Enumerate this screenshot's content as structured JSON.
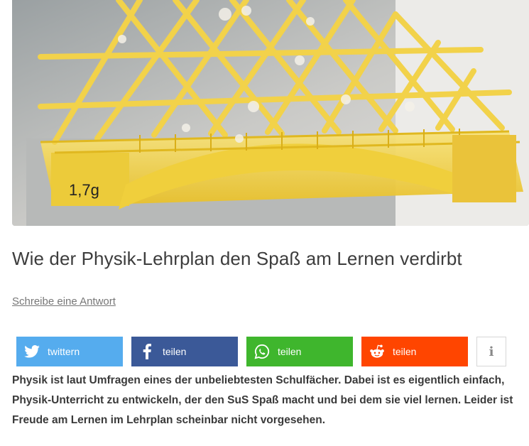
{
  "article": {
    "title": "Wie der Physik-Lehrplan den Spaß am Lernen verdirbt",
    "reply_link": "Schreibe eine Antwort",
    "intro": "Physik ist laut Umfragen eines der unbeliebtesten Schulfächer. Dabei ist es eigentlich einfach, Physik-Unterricht zu entwickeln, der den SuS Spaß macht und bei dem sie viel lernen. Leider ist Freude am Lernen im Lehrplan scheinbar nicht vorgesehen."
  },
  "hero_image": {
    "label_text": "1,7g"
  },
  "share": {
    "twitter": {
      "label": "twittern",
      "icon": "twitter-bird-icon",
      "color": "#55acee"
    },
    "facebook": {
      "label": "teilen",
      "icon": "facebook-f-icon",
      "color": "#3b5998"
    },
    "whatsapp": {
      "label": "teilen",
      "icon": "whatsapp-icon",
      "color": "#3fb62d"
    },
    "reddit": {
      "label": "teilen",
      "icon": "reddit-alien-icon",
      "color": "#ff4500"
    },
    "info": {
      "label": "i",
      "icon": "info-icon"
    }
  }
}
